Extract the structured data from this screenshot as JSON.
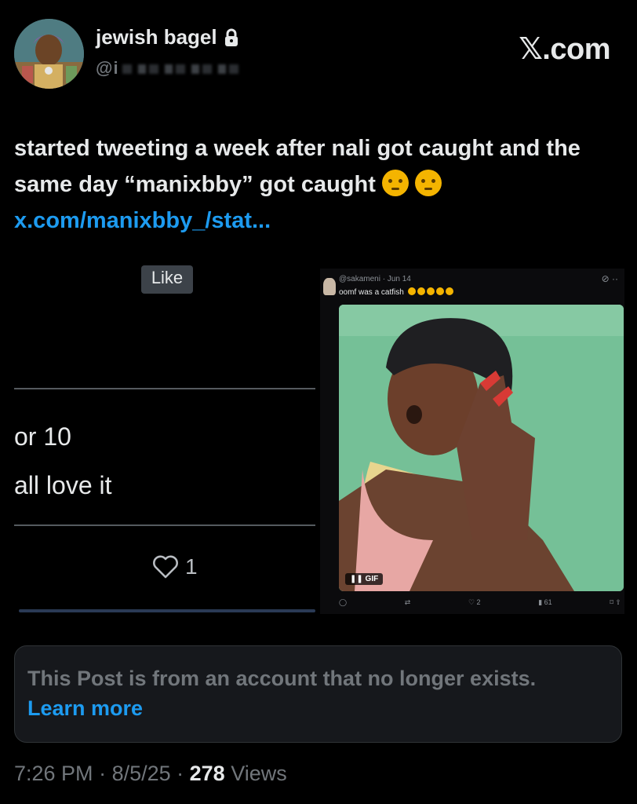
{
  "author": {
    "display_name": "jewish bagel",
    "handle_visible": "@i",
    "avatar_icon": "avatar-icon",
    "lock_icon": "lock-icon"
  },
  "brand": "𝕏.com",
  "tweet": {
    "text": "started tweeting a week after nali got caught and the same day “manixbby” got caught",
    "link": "x.com/manixbby_/stat..."
  },
  "left_screenshot": {
    "like_button": "Like",
    "line1": "or 10",
    "line2": "all love it",
    "like_count": "1"
  },
  "embedded_tweet": {
    "handle": "@sakameni",
    "date": "Jun 14",
    "text": "oomf was a catfish",
    "gif_label": "GIF",
    "likes": "2",
    "views": "61"
  },
  "notice": {
    "message": "This Post is from an account that no longer exists.",
    "link": "Learn more"
  },
  "footer": {
    "time": "7:26 PM",
    "date": "8/5/25",
    "views_count": "278",
    "views_label": "Views"
  }
}
